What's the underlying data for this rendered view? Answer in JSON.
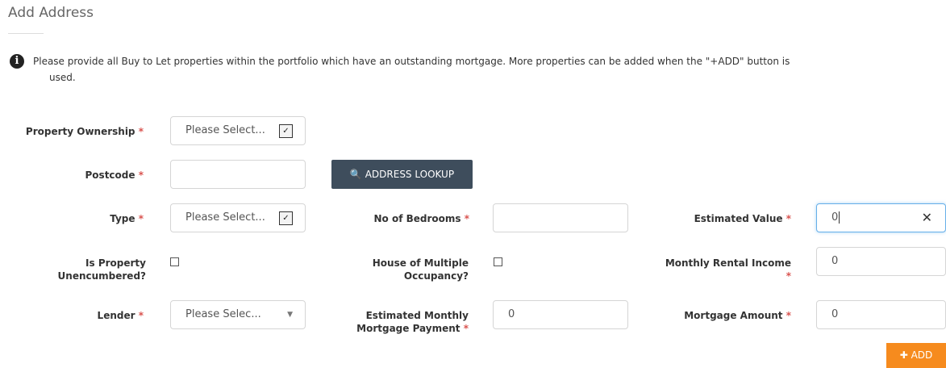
{
  "page": {
    "title": "Add Address",
    "info_text_1": "Please provide all Buy to Let properties within the portfolio which have an outstanding mortgage. More properties can be added when the \"+ADD\" button is",
    "info_text_2": "used.",
    "info_icon": "info-circle-icon"
  },
  "form": {
    "required_mark": "*",
    "property_ownership": {
      "label": "Property Ownership",
      "value": "Please Select..."
    },
    "postcode": {
      "label": "Postcode",
      "value": ""
    },
    "address_lookup": {
      "label": "ADDRESS LOOKUP",
      "icon": "search-icon"
    },
    "type": {
      "label": "Type",
      "value": "Please Select..."
    },
    "no_of_bedrooms": {
      "label": "No of Bedrooms",
      "value": ""
    },
    "estimated_value": {
      "label": "Estimated Value",
      "value": "0",
      "clear": "✕"
    },
    "unencumbered": {
      "label_1": "Is Property",
      "label_2": "Unencumbered?",
      "checked": false
    },
    "hmo": {
      "label_1": "House of Multiple",
      "label_2": "Occupancy?",
      "checked": false
    },
    "monthly_rental_income": {
      "label": "Monthly Rental Income",
      "value": "0"
    },
    "lender": {
      "label": "Lender",
      "value": "Please Selec..."
    },
    "est_monthly_payment": {
      "label_1": "Estimated Monthly",
      "label_2": "Mortgage Payment",
      "value": "0"
    },
    "mortgage_amount": {
      "label": "Mortgage Amount",
      "value": "0"
    }
  },
  "actions": {
    "add_label": "ADD",
    "add_icon": "plus-icon"
  },
  "colors": {
    "lookup_bg": "#3e4d5c",
    "add_bg": "#f68b1e",
    "required": "#d9534f",
    "focus": "#66afe9"
  }
}
